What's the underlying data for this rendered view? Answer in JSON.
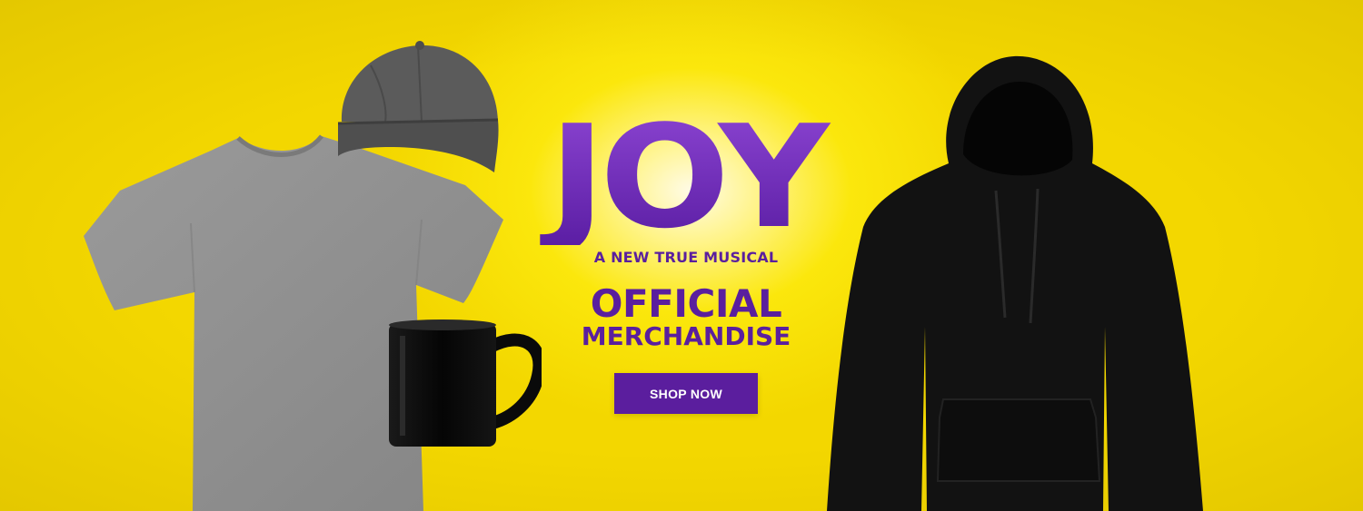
{
  "banner": {
    "logo": "JOY",
    "subtitle": "A NEW TRUE MUSICAL",
    "headline_1": "OFFICIAL",
    "headline_2": "MERCHANDISE",
    "cta_label": "SHOP NOW",
    "colors": {
      "background": "#f8e200",
      "brand_purple": "#5a1f9e",
      "button": "#5b1e9e"
    }
  },
  "products": [
    {
      "icon": "tshirt-icon",
      "label": ""
    },
    {
      "icon": "cap-icon",
      "label": ""
    },
    {
      "icon": "mug-icon",
      "label": ""
    },
    {
      "icon": "hoodie-icon",
      "label": ""
    }
  ]
}
